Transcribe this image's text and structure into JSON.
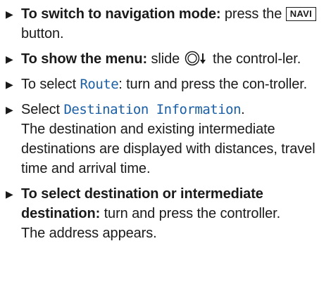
{
  "steps": [
    {
      "bold_label": "To switch to navigation mode:",
      "text_before_key": " press the ",
      "key_label": "NAVI",
      "text_after_key": " button."
    },
    {
      "bold_label": "To show the menu:",
      "text_before_icon": " slide ",
      "icon": "controller-slide-down-icon",
      "text_after_icon": " the control-ler."
    },
    {
      "text_before_ui": "To select ",
      "ui_label": "Route",
      "text_after_ui": ": turn and press the con-troller."
    },
    {
      "text_before_ui": "Select ",
      "ui_label": "Destination Information",
      "text_after_ui": ".",
      "description": "The destination and existing intermediate destinations are displayed with distances, travel time and arrival time."
    },
    {
      "bold_label": "To select destination or intermediate destination:",
      "text_after_label": " turn and press the controller.",
      "description": "The address appears."
    }
  ],
  "colors": {
    "ui_text": "#1a5fa6",
    "body_text": "#1a1a1a"
  }
}
